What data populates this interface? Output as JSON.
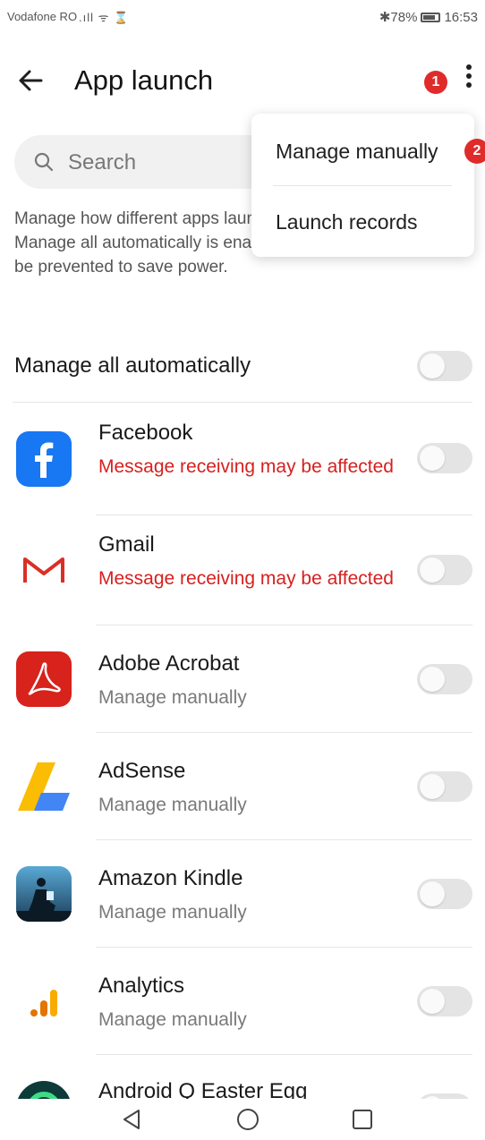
{
  "status_bar": {
    "carrier": "Vodafone RO",
    "signal_glyphs": ".ıll ᯤ ⌛",
    "battery_text": "✱78%",
    "time": "16:53"
  },
  "header": {
    "title": "App launch",
    "step_badge_1": "1",
    "step_badge_2": "2"
  },
  "search": {
    "placeholder": "Search"
  },
  "description": "Manage how different apps launch on your device. When Manage all automatically is enabled, some app launches will be prevented to save power.",
  "menu": {
    "items": [
      {
        "label": "Manage manually"
      },
      {
        "label": "Launch records"
      }
    ]
  },
  "manage_all": {
    "label": "Manage all automatically",
    "enabled": false
  },
  "apps": [
    {
      "name": "Facebook",
      "status": "Message receiving may be affected",
      "warning": true,
      "icon": "facebook-icon"
    },
    {
      "name": "Gmail",
      "status": "Message receiving may be affected",
      "warning": true,
      "icon": "gmail-icon"
    },
    {
      "name": "Adobe Acrobat",
      "status": "Manage manually",
      "warning": false,
      "icon": "adobe-acrobat-icon"
    },
    {
      "name": "AdSense",
      "status": "Manage manually",
      "warning": false,
      "icon": "adsense-icon"
    },
    {
      "name": "Amazon Kindle",
      "status": "Manage manually",
      "warning": false,
      "icon": "kindle-icon"
    },
    {
      "name": "Analytics",
      "status": "Manage manually",
      "warning": false,
      "icon": "analytics-icon"
    },
    {
      "name": "Android Q Easter Egg",
      "status": "",
      "warning": false,
      "icon": "android-q-icon"
    }
  ],
  "colors": {
    "warning_text": "#d62020",
    "badge": "#e02b2b",
    "toggle_off": "#e4e4e4"
  }
}
